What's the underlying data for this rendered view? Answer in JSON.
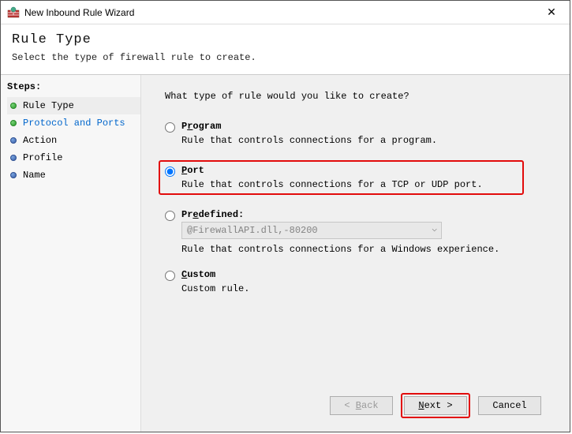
{
  "window": {
    "title": "New Inbound Rule Wizard",
    "close": "✕"
  },
  "header": {
    "title": "Rule Type",
    "subtitle": "Select the type of firewall rule to create."
  },
  "sidebar": {
    "label": "Steps:",
    "items": [
      {
        "label": "Rule Type"
      },
      {
        "label": "Protocol and Ports"
      },
      {
        "label": "Action"
      },
      {
        "label": "Profile"
      },
      {
        "label": "Name"
      }
    ]
  },
  "main": {
    "prompt": "What type of rule would you like to create?",
    "options": {
      "program": {
        "label_pre": "P",
        "label_ul": "r",
        "label_post": "ogram",
        "desc": "Rule that controls connections for a program."
      },
      "port": {
        "label_pre": "",
        "label_ul": "P",
        "label_post": "ort",
        "desc": "Rule that controls connections for a TCP or UDP port."
      },
      "predefined": {
        "label_pre": "Pr",
        "label_ul": "e",
        "label_post": "defined:",
        "select_value": "@FirewallAPI.dll,-80200",
        "desc": "Rule that controls connections for a Windows experience."
      },
      "custom": {
        "label_pre": "",
        "label_ul": "C",
        "label_post": "ustom",
        "desc": "Custom rule."
      }
    }
  },
  "footer": {
    "back_pre": "< ",
    "back_ul": "B",
    "back_post": "ack",
    "next_pre": "",
    "next_ul": "N",
    "next_post": "ext >",
    "cancel": "Cancel"
  }
}
